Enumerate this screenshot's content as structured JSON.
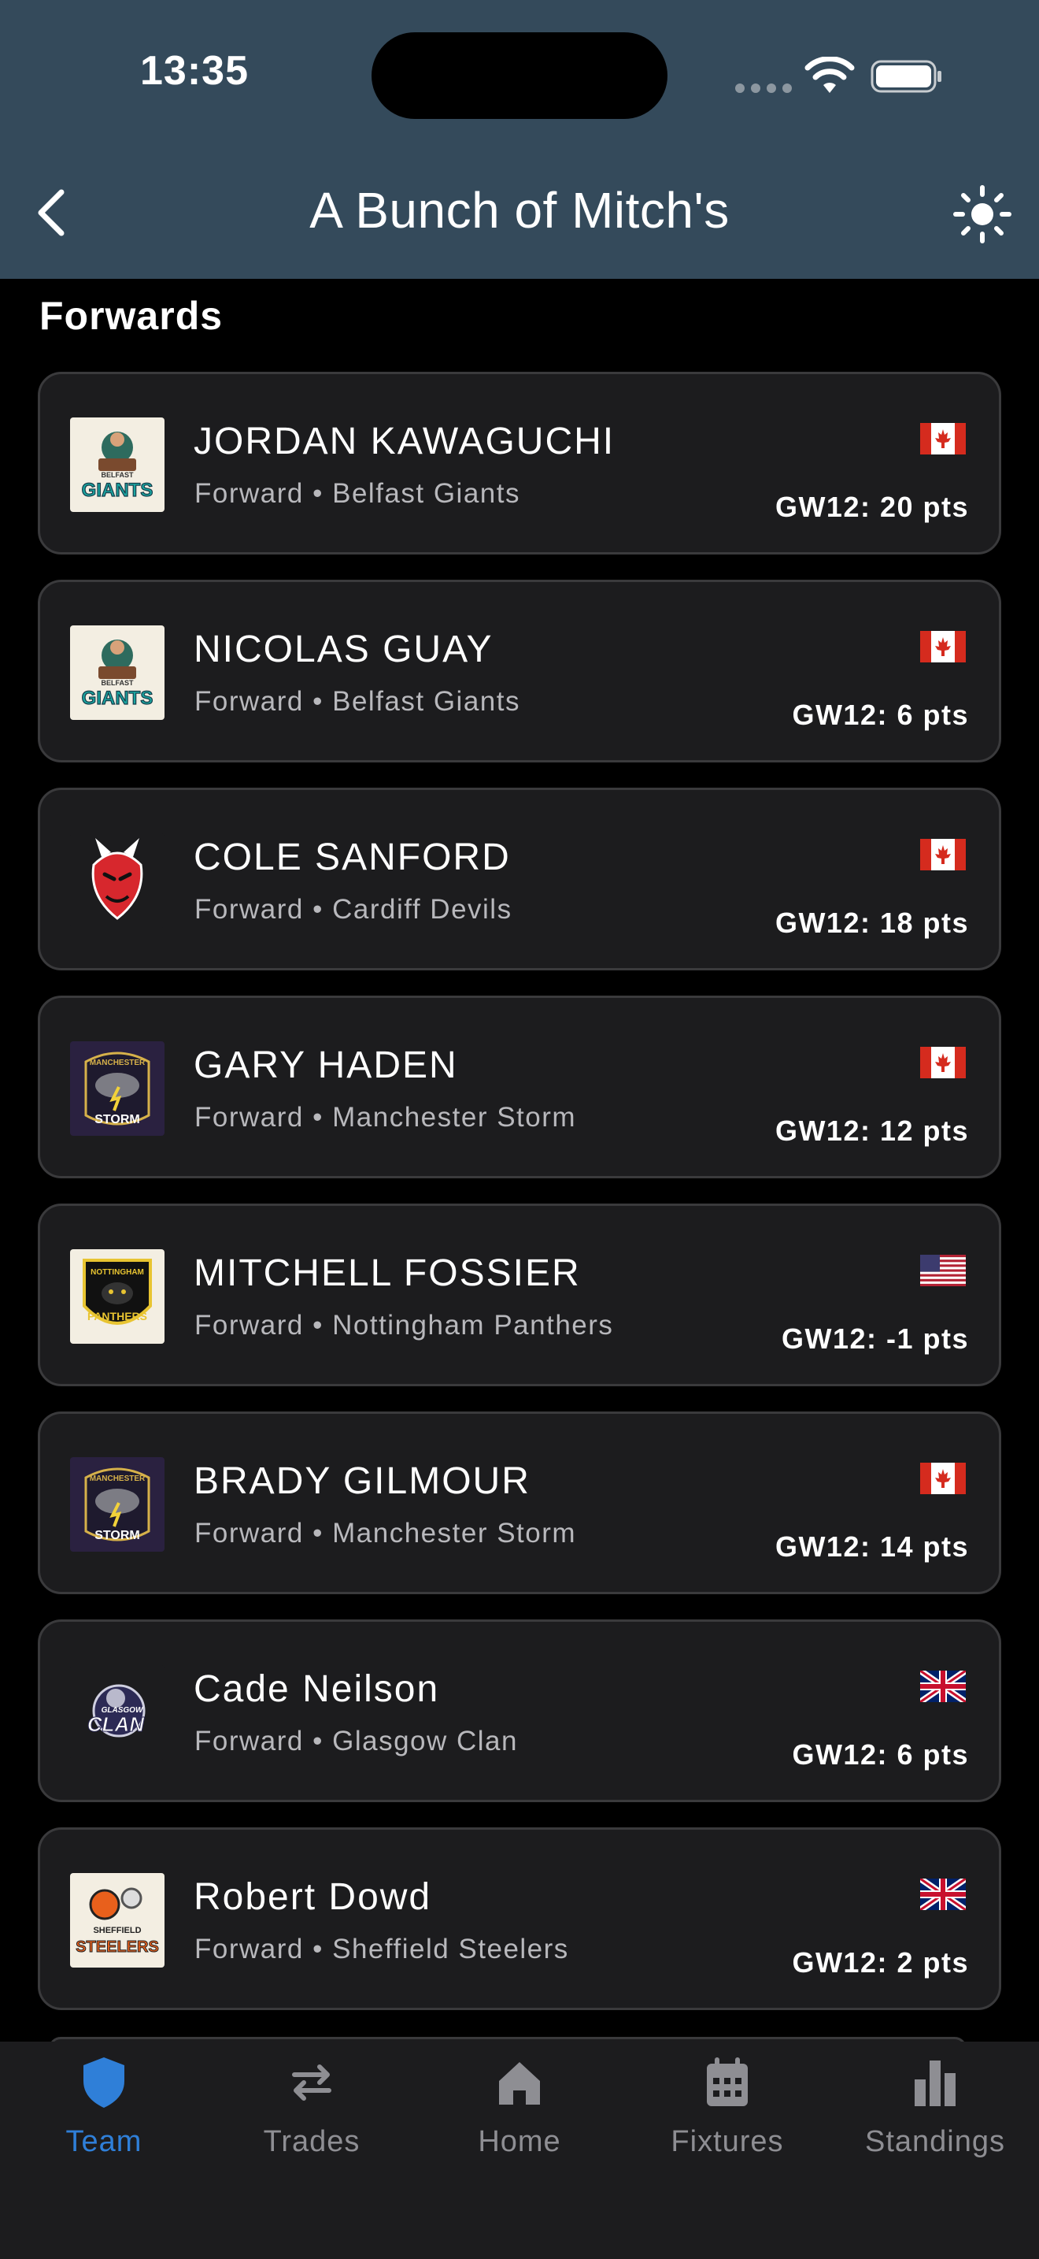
{
  "status_bar": {
    "time": "13:35"
  },
  "header": {
    "title": "A Bunch of Mitch's"
  },
  "section": {
    "title": "Forwards"
  },
  "players": [
    {
      "name": "JORDAN KAWAGUCHI",
      "position": "Forward",
      "team": "Belfast Giants",
      "flag": "canada",
      "points": "GW12: 20 pts",
      "logo": "belfast-giants"
    },
    {
      "name": "NICOLAS GUAY",
      "position": "Forward",
      "team": "Belfast Giants",
      "flag": "canada",
      "points": "GW12: 6 pts",
      "logo": "belfast-giants"
    },
    {
      "name": "COLE SANFORD",
      "position": "Forward",
      "team": "Cardiff Devils",
      "flag": "canada",
      "points": "GW12: 18 pts",
      "logo": "cardiff-devils"
    },
    {
      "name": "GARY HADEN",
      "position": "Forward",
      "team": "Manchester Storm",
      "flag": "canada",
      "points": "GW12: 12 pts",
      "logo": "manchester-storm"
    },
    {
      "name": "MITCHELL FOSSIER",
      "position": "Forward",
      "team": "Nottingham Panthers",
      "flag": "usa",
      "points": "GW12: -1 pts",
      "logo": "nottingham-panthers"
    },
    {
      "name": "BRADY GILMOUR",
      "position": "Forward",
      "team": "Manchester Storm",
      "flag": "canada",
      "points": "GW12: 14 pts",
      "logo": "manchester-storm"
    },
    {
      "name": "Cade Neilson",
      "position": "Forward",
      "team": "Glasgow Clan",
      "flag": "uk",
      "points": "GW12: 6 pts",
      "logo": "glasgow-clan"
    },
    {
      "name": "Robert Dowd",
      "position": "Forward",
      "team": "Sheffield Steelers",
      "flag": "uk",
      "points": "GW12: 2 pts",
      "logo": "sheffield-steelers"
    }
  ],
  "separator": "•",
  "tabbar": {
    "tabs": [
      {
        "label": "Team",
        "icon": "shield-icon",
        "active": true
      },
      {
        "label": "Trades",
        "icon": "swap-arrows-icon",
        "active": false
      },
      {
        "label": "Home",
        "icon": "home-icon",
        "active": false
      },
      {
        "label": "Fixtures",
        "icon": "calendar-icon",
        "active": false
      },
      {
        "label": "Standings",
        "icon": "bar-chart-icon",
        "active": false
      }
    ]
  },
  "colors": {
    "header_bg": "#344a5b",
    "card_bg": "#1c1c1e",
    "card_border": "#3a3a3c",
    "accent": "#2f7fd8",
    "tab_inactive": "#8e8e93"
  }
}
